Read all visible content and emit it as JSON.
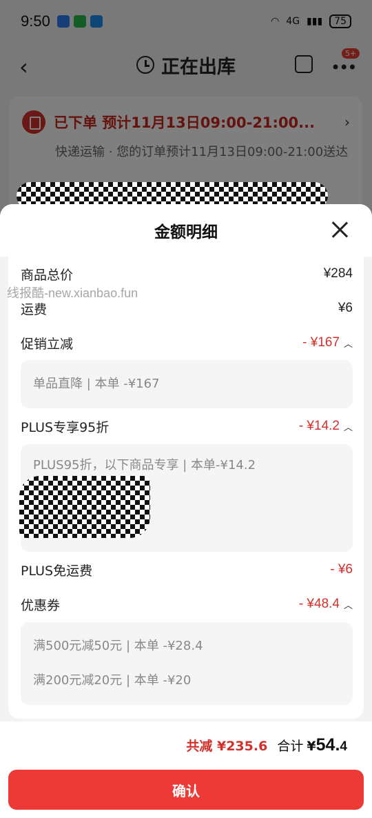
{
  "status_bar": {
    "time": "9:50",
    "network": "4G",
    "battery": "75",
    "app_icons": [
      "blue-app-icon",
      "wechat-icon",
      "chat-bubble-icon"
    ]
  },
  "nav": {
    "title": "正在出库",
    "badge": "5+"
  },
  "order": {
    "status": "已下单  预计11月13日09:00-21:00...",
    "description": "快递运输 · 您的订单预计11月13日09:00-21:00送达"
  },
  "sheet": {
    "title": "金额明细",
    "rows": {
      "goods_total": {
        "label": "商品总价",
        "value": "¥284"
      },
      "shipping": {
        "label": "运费",
        "value": "¥6"
      },
      "promo": {
        "label": "促销立减",
        "value": "- ¥167",
        "detail": "单品直降 | 本单 -¥167"
      },
      "plus": {
        "label": "PLUS专享95折",
        "value": "- ¥14.2",
        "detail": "PLUS95折，以下商品专享 | 本单-¥14.2"
      },
      "plus_free_ship": {
        "label": "PLUS免运费",
        "value": "- ¥6"
      },
      "coupon": {
        "label": "优惠券",
        "value": "- ¥48.4",
        "details": [
          "满500元减50元 | 本单 -¥28.4",
          "满200元减20元 | 本单 -¥20"
        ]
      }
    }
  },
  "watermark": "线报酷-new.xianbao.fun",
  "footer": {
    "saved": "共减 ¥235.6",
    "total_label": "合计",
    "total_symbol": "¥",
    "total_int": "54.",
    "total_dec": "4",
    "confirm": "确认"
  },
  "colors": {
    "accent_red": "#d2302b",
    "button_red": "#ee3a36"
  }
}
